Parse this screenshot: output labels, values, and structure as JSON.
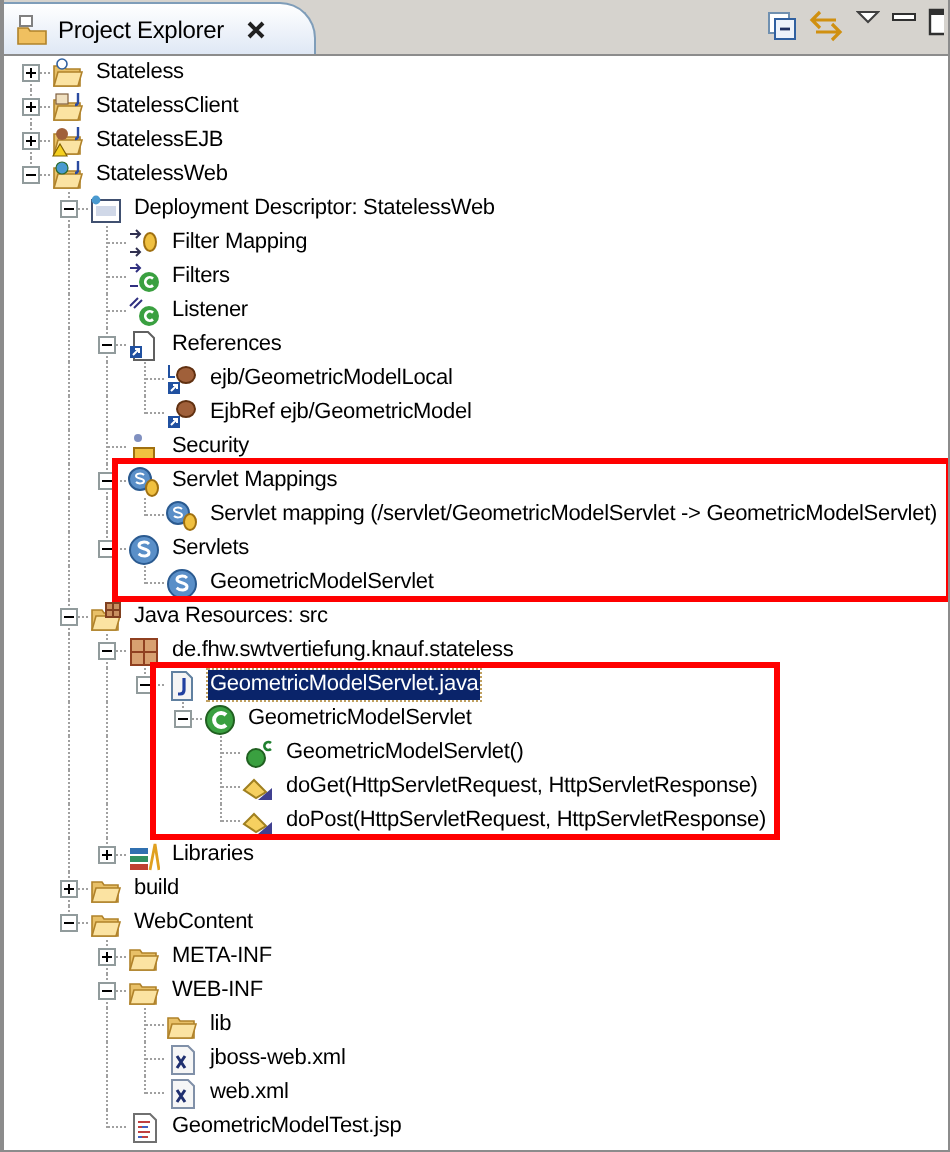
{
  "view": {
    "title": "Project Explorer"
  },
  "tree": [
    {
      "label": "Stateless",
      "kind": "project",
      "expanded": false,
      "selected": false,
      "boxed": false
    },
    {
      "label": "StatelessClient",
      "kind": "client-project",
      "expanded": false,
      "selected": false,
      "boxed": false
    },
    {
      "label": "StatelessEJB",
      "kind": "ejb-project",
      "expanded": false,
      "selected": false,
      "boxed": false
    },
    {
      "label": "StatelessWeb",
      "kind": "web-project",
      "expanded": true,
      "selected": false,
      "boxed": false,
      "children": [
        {
          "label": "Deployment Descriptor: StatelessWeb",
          "kind": "descriptor",
          "expanded": true,
          "selected": false,
          "boxed": false,
          "children": [
            {
              "label": "Filter Mapping",
              "kind": "filter-mapping",
              "selected": false,
              "boxed": false
            },
            {
              "label": "Filters",
              "kind": "filter",
              "selected": false,
              "boxed": false
            },
            {
              "label": "Listener",
              "kind": "listener",
              "selected": false,
              "boxed": false
            },
            {
              "label": "References",
              "kind": "references",
              "expanded": true,
              "selected": false,
              "boxed": false,
              "children": [
                {
                  "label": "ejb/GeometricModelLocal",
                  "kind": "local-ref",
                  "selected": false,
                  "boxed": false
                },
                {
                  "label": "EjbRef ejb/GeometricModel",
                  "kind": "ejb-ref",
                  "selected": false,
                  "boxed": false
                }
              ]
            },
            {
              "label": "Security",
              "kind": "security",
              "selected": false,
              "boxed": false
            },
            {
              "label": "Servlet Mappings",
              "kind": "servlet-mapping",
              "expanded": true,
              "selected": false,
              "boxed": true,
              "children": [
                {
                  "label": "Servlet mapping (/servlet/GeometricModelServlet -> GeometricModelServlet)",
                  "kind": "servlet-mapping",
                  "selected": false,
                  "boxed": true
                }
              ]
            },
            {
              "label": "Servlets",
              "kind": "servlet",
              "expanded": true,
              "selected": false,
              "boxed": true,
              "children": [
                {
                  "label": "GeometricModelServlet",
                  "kind": "servlet",
                  "selected": false,
                  "boxed": true
                }
              ]
            }
          ]
        },
        {
          "label": "Java Resources: src",
          "kind": "java-resources",
          "expanded": true,
          "selected": false,
          "boxed": false,
          "children": [
            {
              "label": "de.fhw.swtvertiefung.knauf.stateless",
              "kind": "package",
              "expanded": true,
              "selected": false,
              "boxed": false,
              "children": [
                {
                  "label": "GeometricModelServlet.java",
                  "kind": "java-file",
                  "expanded": true,
                  "selected": true,
                  "boxed": true,
                  "children": [
                    {
                      "label": "GeometricModelServlet",
                      "kind": "class",
                      "expanded": true,
                      "selected": false,
                      "boxed": true,
                      "children": [
                        {
                          "label": "GeometricModelServlet()",
                          "kind": "constructor",
                          "selected": false,
                          "boxed": true
                        },
                        {
                          "label": "doGet(HttpServletRequest, HttpServletResponse)",
                          "kind": "method",
                          "selected": false,
                          "boxed": true
                        },
                        {
                          "label": "doPost(HttpServletRequest, HttpServletResponse)",
                          "kind": "method",
                          "selected": false,
                          "boxed": true
                        }
                      ]
                    }
                  ]
                }
              ]
            },
            {
              "label": "Libraries",
              "kind": "libraries",
              "expanded": false,
              "selected": false,
              "boxed": false
            }
          ]
        },
        {
          "label": "build",
          "kind": "folder",
          "expanded": false,
          "selected": false,
          "boxed": false
        },
        {
          "label": "WebContent",
          "kind": "folder",
          "expanded": true,
          "selected": false,
          "boxed": false,
          "children": [
            {
              "label": "META-INF",
              "kind": "folder",
              "expanded": false,
              "selected": false,
              "boxed": false
            },
            {
              "label": "WEB-INF",
              "kind": "folder",
              "expanded": true,
              "selected": false,
              "boxed": false,
              "children": [
                {
                  "label": "lib",
                  "kind": "folder",
                  "selected": false,
                  "boxed": false
                },
                {
                  "label": "jboss-web.xml",
                  "kind": "xml-file",
                  "selected": false,
                  "boxed": false
                },
                {
                  "label": "web.xml",
                  "kind": "xml-file",
                  "selected": false,
                  "boxed": false
                }
              ]
            },
            {
              "label": "GeometricModelTest.jsp",
              "kind": "jsp-file",
              "selected": false,
              "boxed": false
            }
          ]
        }
      ]
    }
  ]
}
